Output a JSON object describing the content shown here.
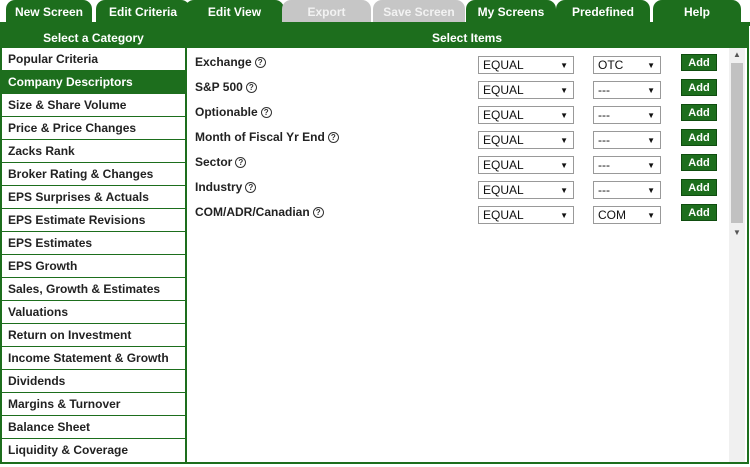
{
  "tabs": [
    {
      "label": "New Screen",
      "state": "active"
    },
    {
      "label": "Edit Criteria",
      "state": "active"
    },
    {
      "label": "Edit View",
      "state": "active"
    },
    {
      "label": "Export",
      "state": "disabled"
    },
    {
      "label": "Save Screen",
      "state": "disabled"
    },
    {
      "label": "My Screens",
      "state": "active"
    },
    {
      "label": "Predefined",
      "state": "active"
    },
    {
      "label": "Help",
      "state": "active"
    }
  ],
  "left_panel": {
    "header": "Select a Category",
    "categories": [
      "Popular Criteria",
      "Company Descriptors",
      "Size & Share Volume",
      "Price & Price Changes",
      "Zacks Rank",
      "Broker Rating & Changes",
      "EPS Surprises & Actuals",
      "EPS Estimate Revisions",
      "EPS Estimates",
      "EPS Growth",
      "Sales, Growth & Estimates",
      "Valuations",
      "Return on Investment",
      "Income Statement & Growth",
      "Dividends",
      "Margins & Turnover",
      "Balance Sheet",
      "Liquidity & Coverage"
    ],
    "selected_index": 1
  },
  "right_panel": {
    "header": "Select Items",
    "help_symbol": "?",
    "add_label": "Add",
    "items": [
      {
        "label": "Exchange",
        "operator": "EQUAL",
        "value": "OTC"
      },
      {
        "label": "S&P 500",
        "operator": "EQUAL",
        "value": "---"
      },
      {
        "label": "Optionable",
        "operator": "EQUAL",
        "value": "---"
      },
      {
        "label": "Month of Fiscal Yr End",
        "operator": "EQUAL",
        "value": "---"
      },
      {
        "label": "Sector",
        "operator": "EQUAL",
        "value": "---"
      },
      {
        "label": "Industry",
        "operator": "EQUAL",
        "value": "---"
      },
      {
        "label": "COM/ADR/Canadian",
        "operator": "EQUAL",
        "value": "COM"
      }
    ]
  },
  "icons": {
    "dropdown_arrow": "▼",
    "scroll_up": "▲",
    "scroll_down": "▼"
  },
  "colors": {
    "primary_green": "#1d6e1d",
    "disabled_tab": "#c6c6c6"
  }
}
